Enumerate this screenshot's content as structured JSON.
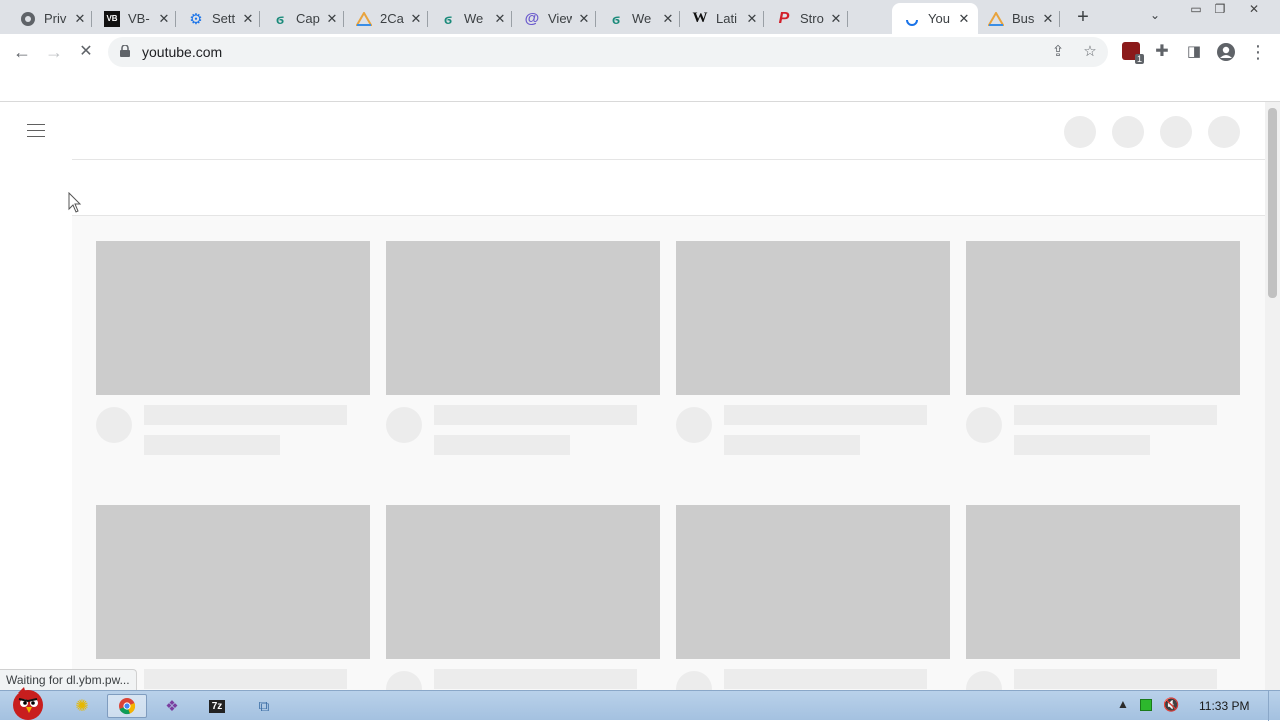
{
  "browser": {
    "tabs": [
      {
        "title": "Priv",
        "icon": "globe-icon",
        "active": false
      },
      {
        "title": "VB-",
        "icon": "vb-icon",
        "active": false
      },
      {
        "title": "Sett",
        "icon": "gear-icon",
        "active": false
      },
      {
        "title": "Cap",
        "icon": "spiral-icon",
        "active": false
      },
      {
        "title": "2Ca",
        "icon": "drive-icon",
        "active": false
      },
      {
        "title": "We",
        "icon": "spiral-icon",
        "active": false
      },
      {
        "title": "View",
        "icon": "at-icon",
        "active": false
      },
      {
        "title": "We",
        "icon": "spiral-icon",
        "active": false
      },
      {
        "title": "Lati",
        "icon": "wikipedia-icon",
        "active": false
      },
      {
        "title": "Stro",
        "icon": "pinterest-icon",
        "active": false
      },
      {
        "title": "You",
        "icon": "loading-spinner-icon",
        "active": true
      },
      {
        "title": "Bus",
        "icon": "drive-icon",
        "active": false
      }
    ],
    "close_glyph": "✕",
    "new_tab_glyph": "+",
    "url": "youtube.com",
    "extension_badge_count": "1",
    "status_text": "Waiting for dl.ybm.pw..."
  },
  "taskbar": {
    "clock": "11:33 PM"
  },
  "colors": {
    "skeleton_thumb": "#cccccc",
    "skeleton_bar": "#ececec",
    "tab_strip": "#dee1e6",
    "taskbar": "#b9d1ea"
  }
}
